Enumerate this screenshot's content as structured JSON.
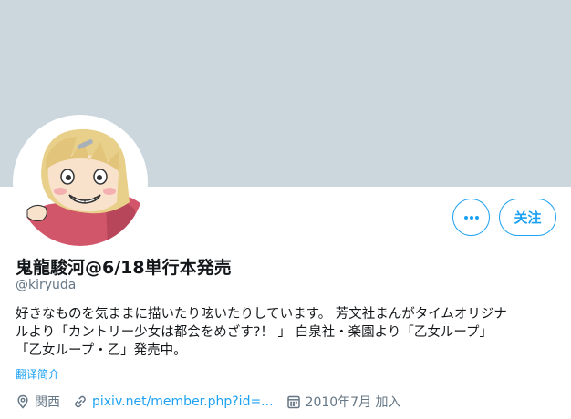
{
  "profile": {
    "display_name": "鬼龍駿河@6/18単行本発売",
    "handle": "@kiryuda",
    "bio_lines": [
      "好きなものを気ままに描いたり呟いたりしています。 芳文社まんがタイムオリジナ",
      "ルより「カントリー少女は都会をめざす?！ 」 白泉社・楽園より「乙女ループ」",
      "「乙女ループ・乙」発売中。"
    ],
    "translate_label": "翻译简介",
    "location": "関西",
    "website": "pixiv.net/member.php?id=...",
    "joined": "2010年7月 加入"
  },
  "actions": {
    "more_label": "•••",
    "follow_label": "关注"
  },
  "colors": {
    "banner": "#ccd6dd",
    "accent": "#1da1f2",
    "secondary_text": "#657786"
  },
  "icons": {
    "location": "map-pin-icon",
    "website": "link-icon",
    "joined": "calendar-icon",
    "more": "more-dots-icon"
  }
}
